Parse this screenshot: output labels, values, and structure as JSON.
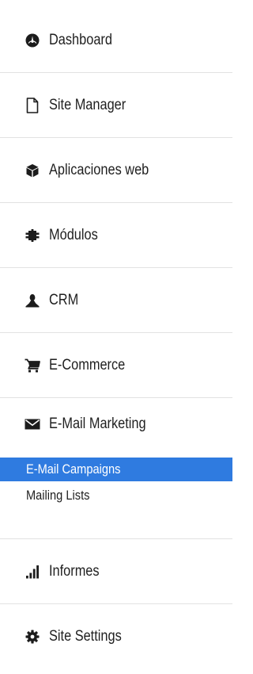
{
  "nav": {
    "dashboard": "Dashboard",
    "site_manager": "Site Manager",
    "web_apps": "Aplicaciones web",
    "modules": "Módulos",
    "crm": "CRM",
    "ecommerce": "E-Commerce",
    "email_marketing": "E-Mail Marketing",
    "email_marketing_sub": {
      "campaigns": "E-Mail Campaigns",
      "mailing_lists": "Mailing Lists"
    },
    "reports": "Informes",
    "site_settings": "Site Settings"
  },
  "colors": {
    "active_background": "#2f7be0",
    "active_text": "#ffffff",
    "divider": "#e2e2e2"
  },
  "icons": {
    "dashboard": "dashboard-icon",
    "site_manager": "file-icon",
    "web_apps": "cube-icon",
    "modules": "puzzle-icon",
    "crm": "user-icon",
    "ecommerce": "shopping-cart-icon",
    "email_marketing": "envelope-icon",
    "reports": "bar-chart-icon",
    "site_settings": "gear-icon"
  }
}
